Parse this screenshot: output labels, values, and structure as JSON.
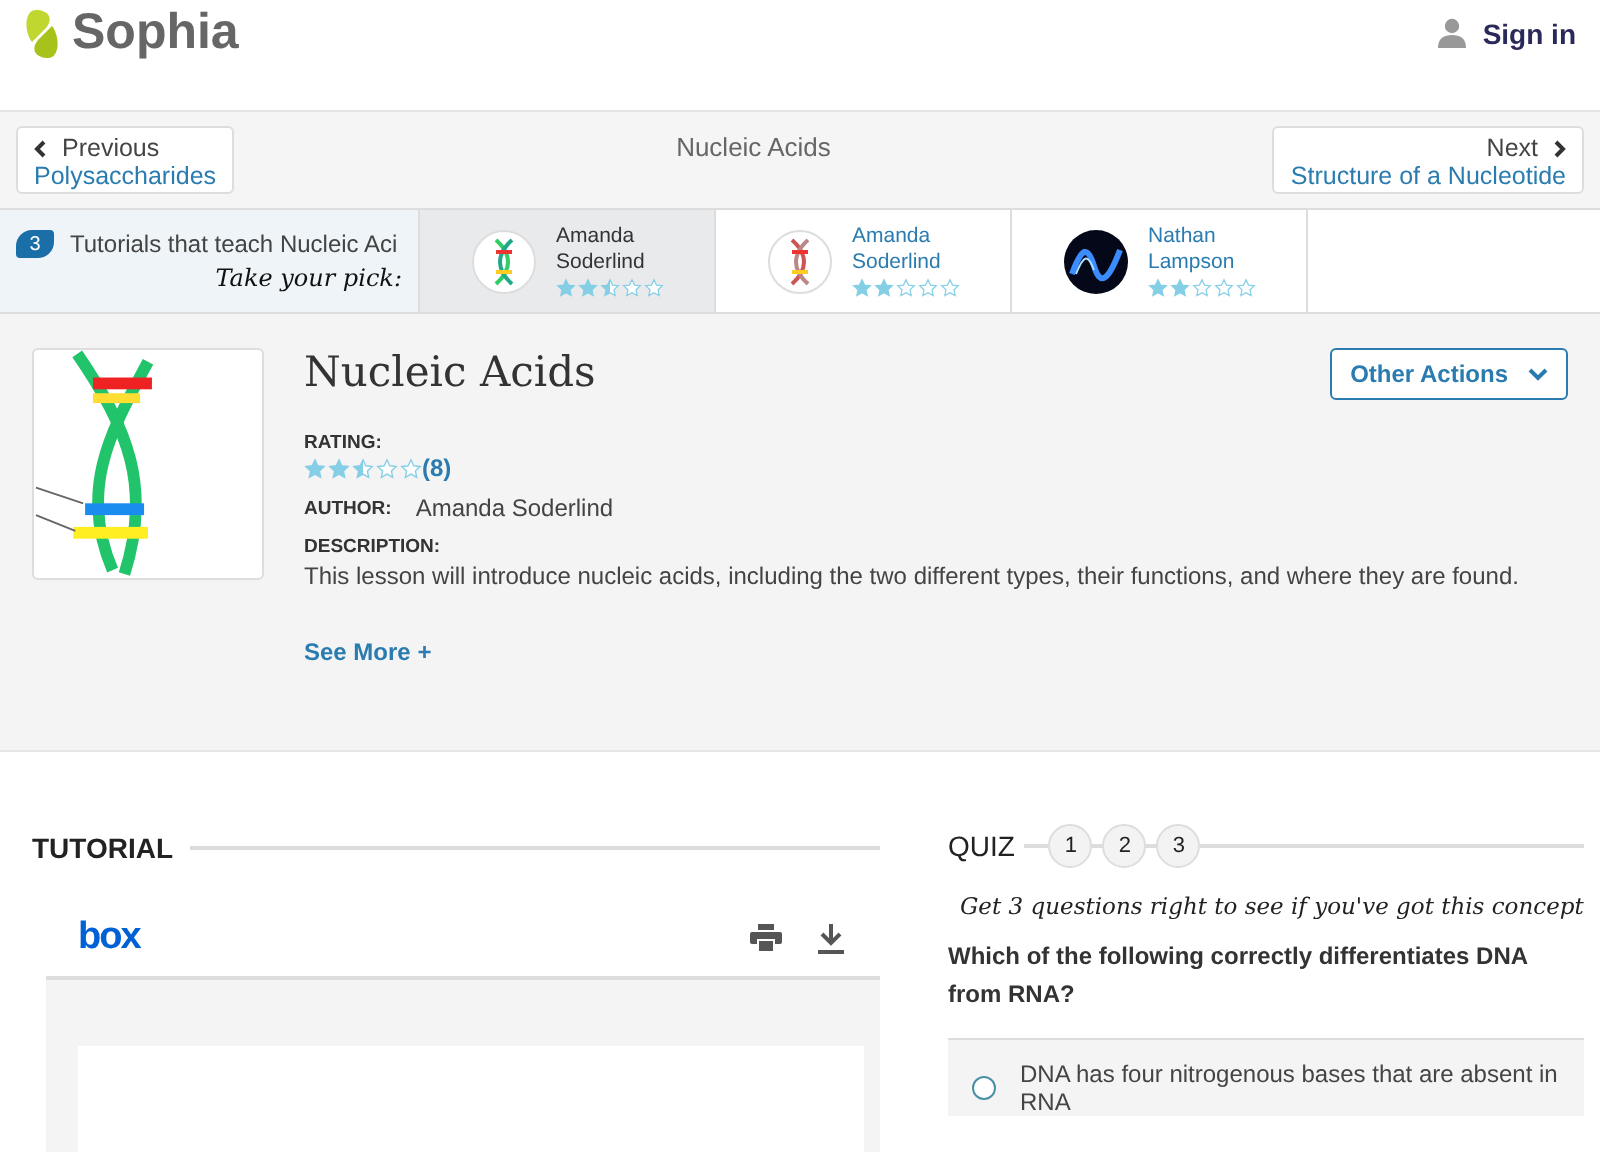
{
  "header": {
    "logo": "Sophia",
    "sign_in": "Sign in"
  },
  "nav": {
    "previous": {
      "label": "Previous",
      "title": "Polysaccharides"
    },
    "current": "Nucleic Acids",
    "next": {
      "label": "Next",
      "title": "Structure of a Nucleotide"
    }
  },
  "tutorials": {
    "count": "3",
    "heading": "Tutorials that teach Nucleic Aci",
    "tagline": "Take your pick:",
    "items": [
      {
        "author": "Amanda Soderlind",
        "stars": 2.5,
        "selected": true
      },
      {
        "author": "Amanda Soderlind",
        "stars": 2,
        "selected": false
      },
      {
        "author": "Nathan Lampson",
        "stars": 2,
        "selected": false
      }
    ]
  },
  "lesson": {
    "title": "Nucleic Acids",
    "actions": "Other Actions",
    "rating_label": "RATING:",
    "stars": 2.5,
    "rating_count": "(8)",
    "author_label": "AUTHOR:",
    "author": "Amanda Soderlind",
    "description_label": "DESCRIPTION:",
    "description": "This lesson will introduce nucleic acids, including the two different types, their functions, and where they are found.",
    "see_more": "See More +"
  },
  "tutorial": {
    "heading": "TUTORIAL",
    "viewer_logo": "box"
  },
  "quiz": {
    "heading": "QUIZ",
    "steps": [
      "1",
      "2",
      "3"
    ],
    "prompt": "Get 3 questions right to see if you've got this concept",
    "question": "Which of the following correctly differentiates DNA from RNA?",
    "answers": [
      {
        "text": "DNA has four nitrogenous bases that are absent in RNA",
        "selected": false
      }
    ]
  }
}
